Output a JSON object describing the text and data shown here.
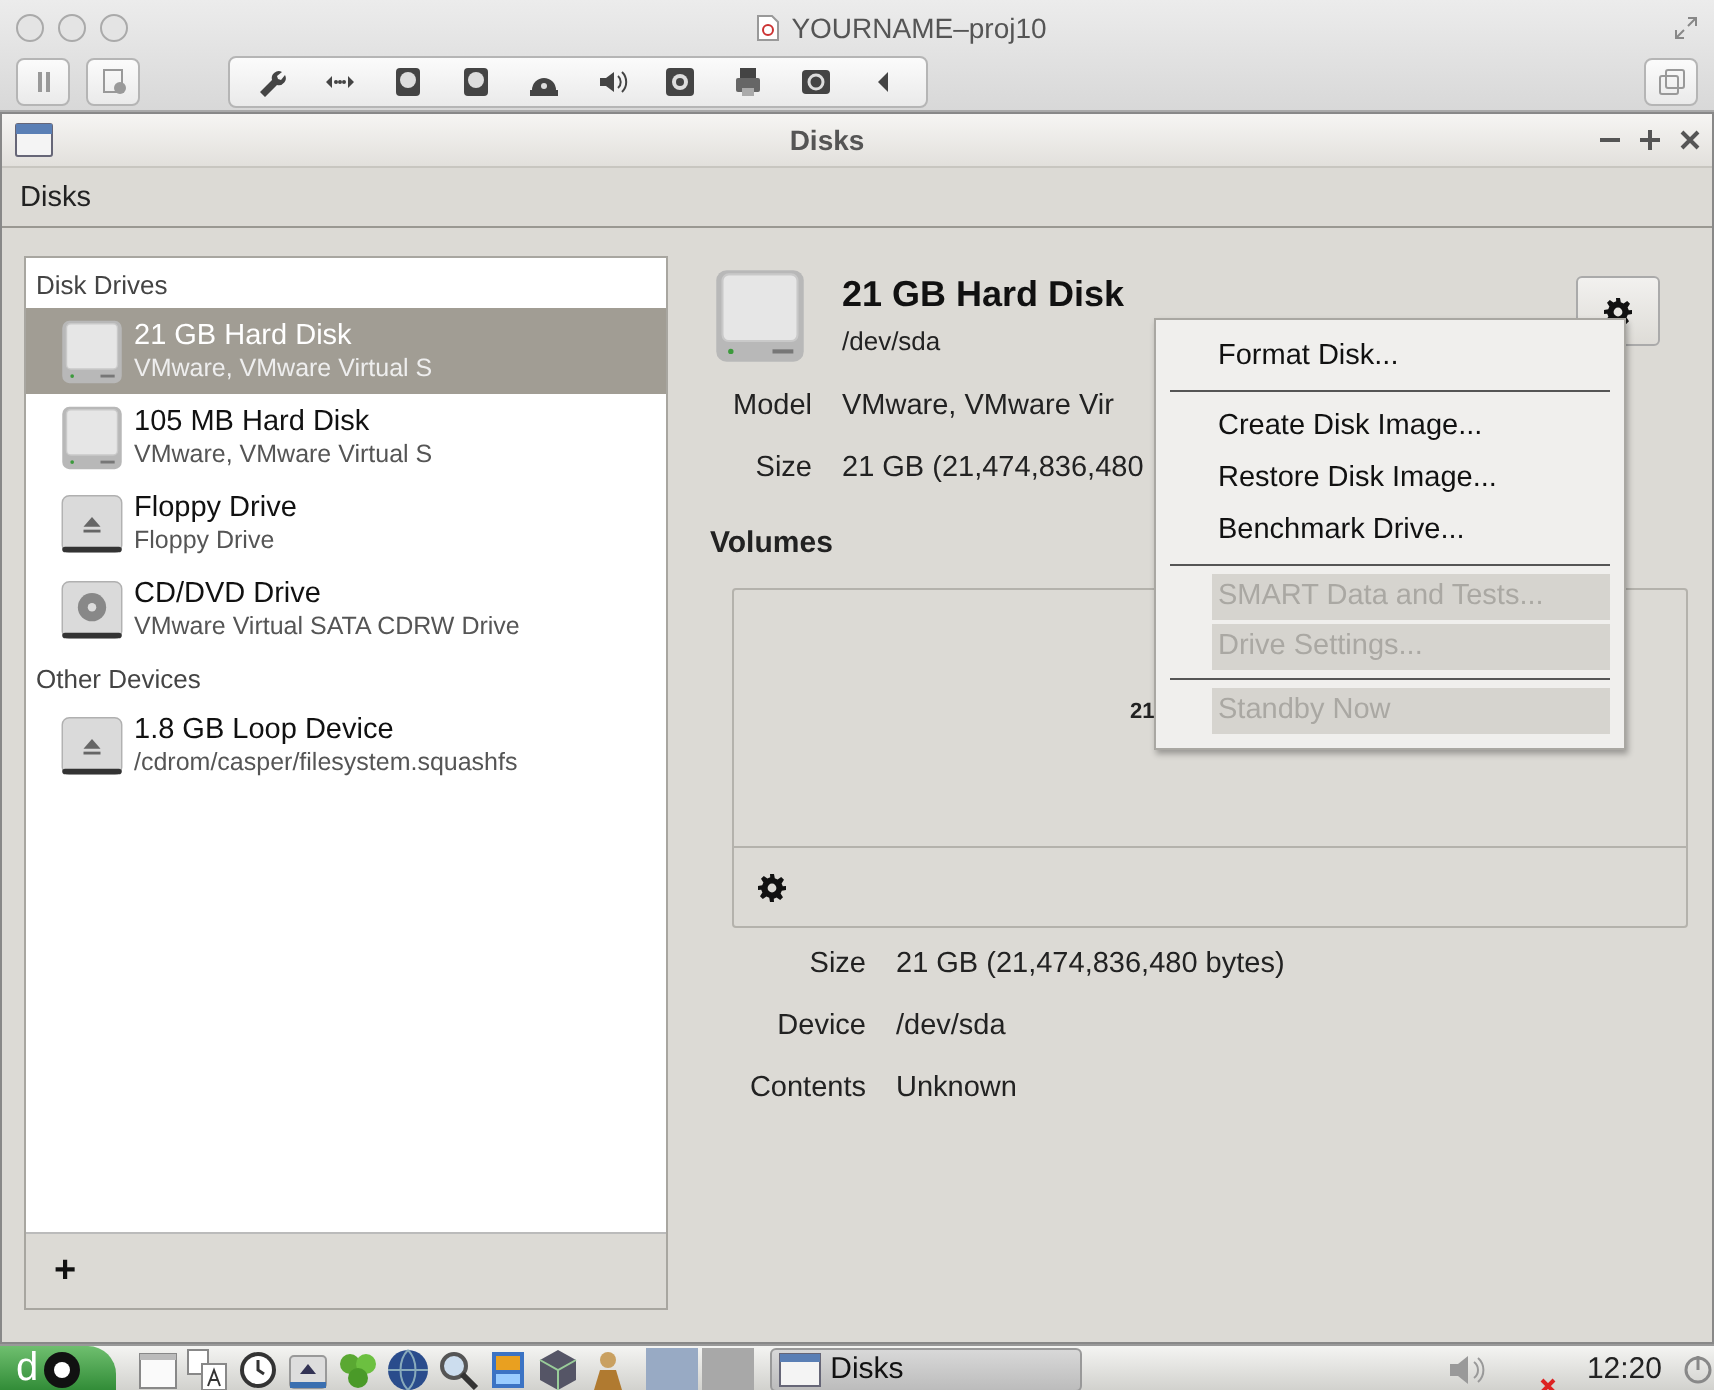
{
  "vm_window": {
    "title": "YOURNAME–proj10"
  },
  "app_window": {
    "title": "Disks"
  },
  "menubar": {
    "label": "Disks"
  },
  "sidebar": {
    "groups": [
      {
        "heading": "Disk Drives",
        "items": [
          {
            "name": "21 GB Hard Disk",
            "detail": "VMware, VMware Virtual S",
            "kind": "hdd",
            "selected": true
          },
          {
            "name": "105 MB Hard Disk",
            "detail": "VMware, VMware Virtual S",
            "kind": "hdd",
            "selected": false
          },
          {
            "name": "Floppy Drive",
            "detail": "Floppy Drive",
            "kind": "removable",
            "selected": false
          },
          {
            "name": "CD/DVD Drive",
            "detail": "VMware Virtual SATA CDRW Drive",
            "kind": "optical",
            "selected": false
          }
        ]
      },
      {
        "heading": "Other Devices",
        "items": [
          {
            "name": "1.8 GB Loop Device",
            "detail": "/cdrom/casper/filesystem.squashfs",
            "kind": "removable",
            "selected": false
          }
        ]
      }
    ],
    "add_label": "+"
  },
  "drive": {
    "title": "21 GB Hard Disk",
    "path": "/dev/sda",
    "fields": [
      {
        "label": "Model",
        "value": "VMware, VMware Vir"
      },
      {
        "label": "Size",
        "value": "21 GB (21,474,836,480"
      }
    ]
  },
  "volumes": {
    "heading": "Volumes",
    "map_label": "21",
    "fields": [
      {
        "label": "Size",
        "value": "21 GB (21,474,836,480 bytes)"
      },
      {
        "label": "Device",
        "value": "/dev/sda"
      },
      {
        "label": "Contents",
        "value": "Unknown"
      }
    ]
  },
  "menu": {
    "items": [
      {
        "kind": "item",
        "label": "Format Disk...",
        "disabled": false
      },
      {
        "kind": "separator"
      },
      {
        "kind": "item",
        "label": "Create Disk Image...",
        "disabled": false
      },
      {
        "kind": "item",
        "label": "Restore Disk Image...",
        "disabled": false
      },
      {
        "kind": "item",
        "label": "Benchmark Drive...",
        "disabled": false
      },
      {
        "kind": "separator"
      },
      {
        "kind": "item",
        "label": "SMART Data and Tests...",
        "disabled": true
      },
      {
        "kind": "item",
        "label": "Drive Settings...",
        "disabled": true
      },
      {
        "kind": "separator"
      },
      {
        "kind": "item",
        "label": "Standby Now",
        "disabled": true
      }
    ]
  },
  "taskbar": {
    "start_label": "d",
    "workspaces": [
      {
        "selected": true
      },
      {
        "selected": false
      }
    ],
    "tasks": [
      {
        "label": "Disks"
      }
    ],
    "clock": "12:20"
  }
}
